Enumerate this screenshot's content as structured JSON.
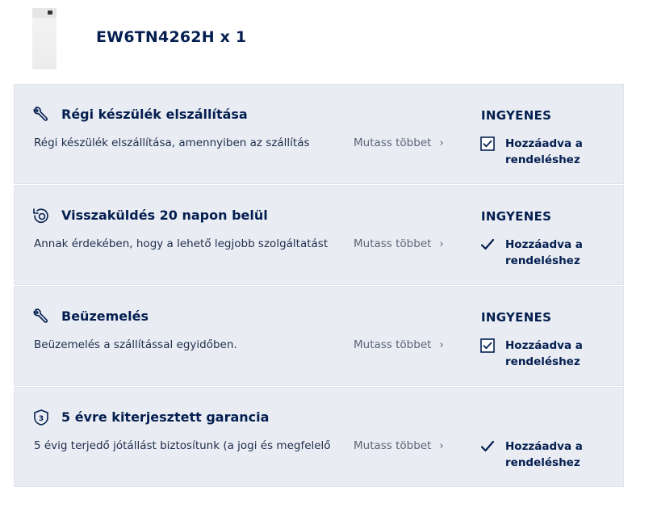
{
  "product": {
    "image_alt": "washing machine",
    "title": "EW6TN4262H x 1"
  },
  "services": [
    {
      "icon": "wrench-icon",
      "title": "Régi készülék elszállítása",
      "description": "Régi készülék elszállítása, amennyiben az szállítás",
      "more_label": "Mutass többet",
      "price": "INGYENES",
      "added_label": "Hozzáadva a rendeléshez",
      "control": "checkbox",
      "checked": true
    },
    {
      "icon": "return-icon",
      "title": "Visszaküldés 20 napon belül",
      "description": "Annak érdekében, hogy a lehető legjobb szolgáltatást",
      "more_label": "Mutass többet",
      "price": "INGYENES",
      "added_label": "Hozzáadva a rendeléshez",
      "control": "checkmark",
      "checked": true
    },
    {
      "icon": "wrench-icon",
      "title": "Beüzemelés",
      "description": "Beüzemelés a szállítással egyidőben.",
      "more_label": "Mutass többet",
      "price": "INGYENES",
      "added_label": "Hozzáadva a rendeléshez",
      "control": "checkbox",
      "checked": true
    },
    {
      "icon": "shield-3-icon",
      "title": "5 évre kiterjesztett garancia",
      "description": "5 évig terjedő jótállást biztosítunk (a jogi és megfelelő",
      "more_label": "Mutass többet",
      "price": "",
      "added_label": "Hozzáadva a rendeléshez",
      "control": "checkmark",
      "checked": true
    }
  ],
  "colors": {
    "navy": "#041e50",
    "card_bg": "#e9edf3",
    "muted": "#5b6478"
  }
}
